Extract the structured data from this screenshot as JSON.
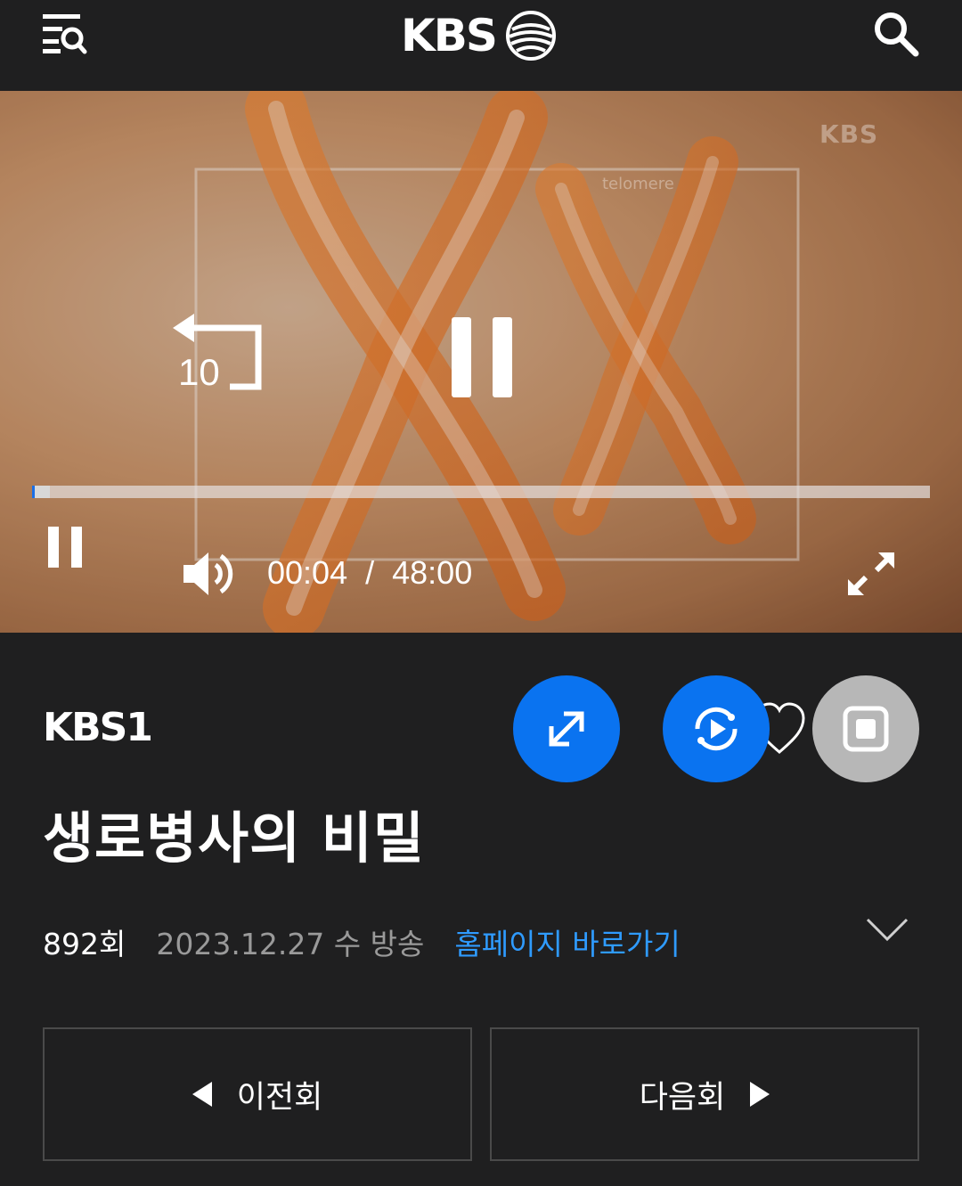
{
  "header": {
    "logo_text": "KBS",
    "menu_icon": "menu-search-icon",
    "search_icon": "search-icon"
  },
  "player": {
    "watermark": "KBS",
    "overlay_text": "telomere",
    "rewind_seconds": "10",
    "current_time": "00:04",
    "separator": "/",
    "duration": "48:00",
    "progress_fraction": 0.02,
    "progress_color": "#1b6fe8"
  },
  "channel": {
    "logo_text": "KBS1"
  },
  "actions": {
    "expand_color": "#0a73f0",
    "replay_color": "#0a73f0",
    "stop_color": "#b7b7b7"
  },
  "program": {
    "title": "생로병사의 비밀",
    "episode": "892회",
    "air_date": "2023.12.27 수 방송",
    "homepage_link": "홈페이지 바로가기"
  },
  "navigation": {
    "prev_label": "이전회",
    "next_label": "다음회"
  }
}
